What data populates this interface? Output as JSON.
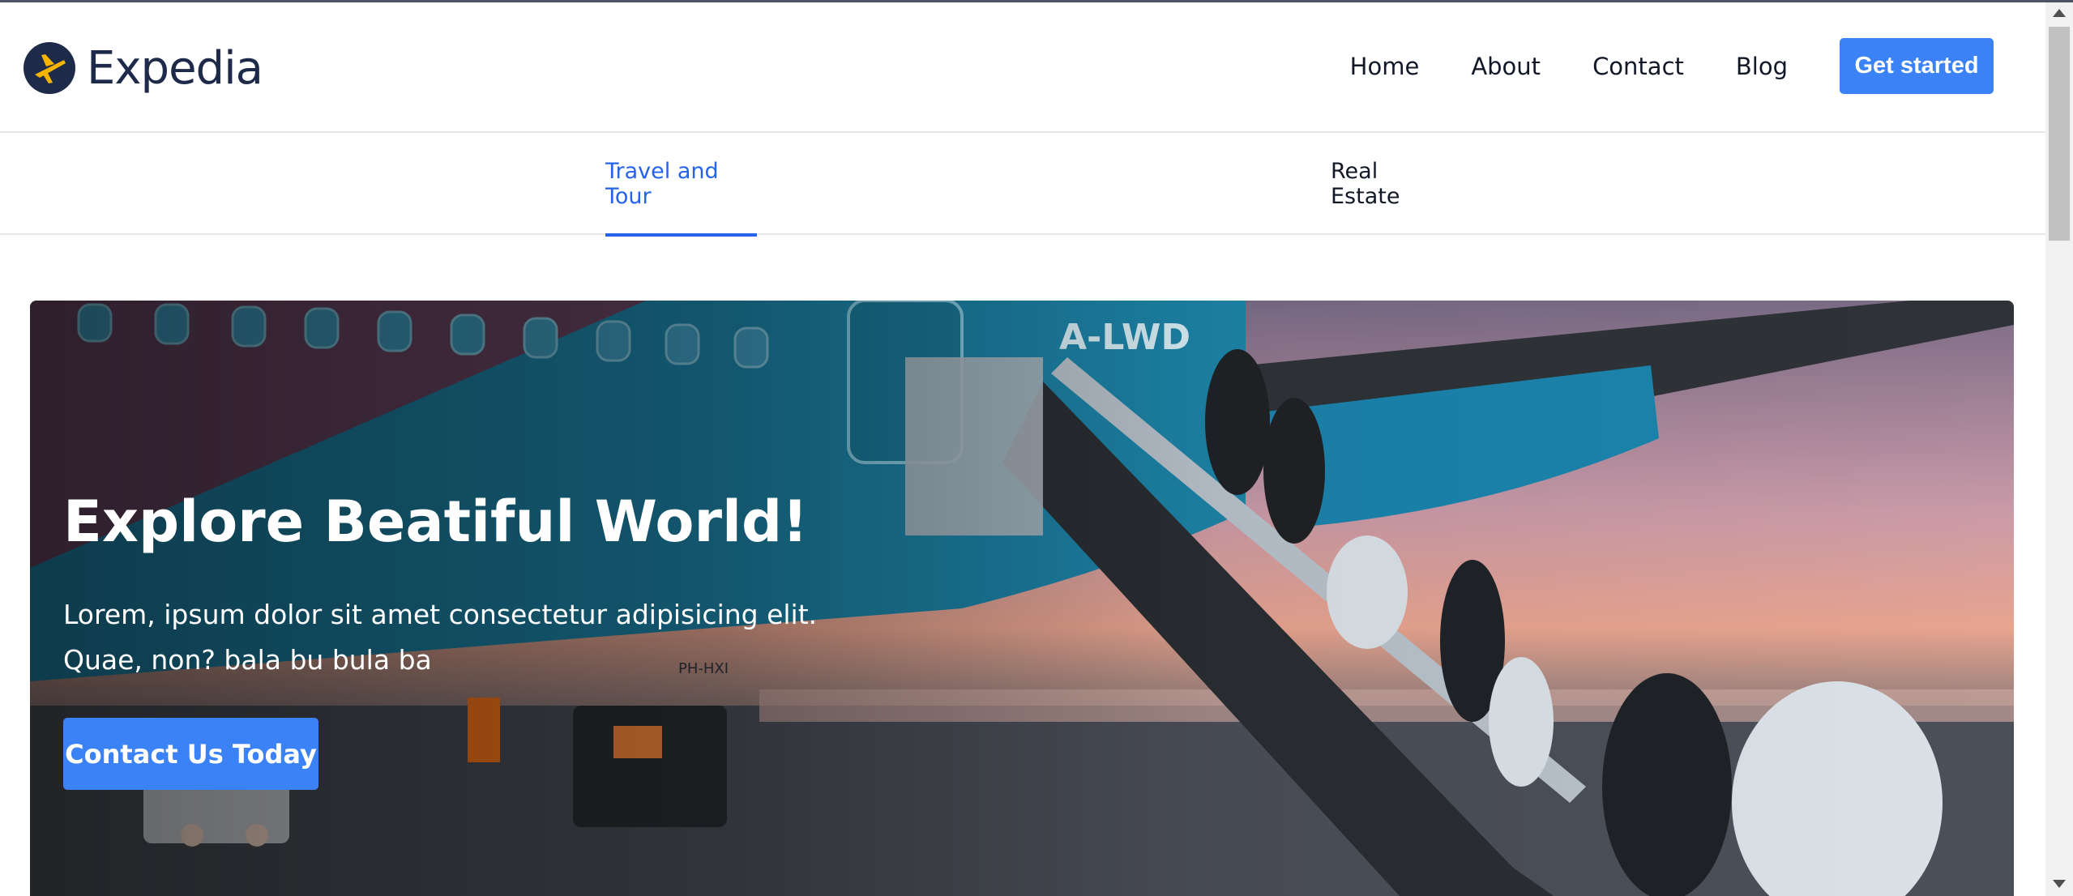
{
  "brand": {
    "name": "Expedia",
    "icon": "airplane-logo-icon"
  },
  "nav": {
    "links": [
      "Home",
      "About",
      "Contact",
      "Blog"
    ],
    "cta_label": "Get started"
  },
  "tabs": [
    {
      "label": "Travel and Tour",
      "active": true
    },
    {
      "label": "Real Estate",
      "active": false
    }
  ],
  "hero": {
    "title": "Explore Beatiful World!",
    "text": "Lorem, ipsum dolor sit amet consectetur adipisicing elit. Quae, non? bala bu bula ba",
    "button_label": "Contact Us Today",
    "image_text": {
      "registration": "A-LWD",
      "side_mark": "PH-HXI"
    }
  },
  "colors": {
    "accent": "#3b82f6",
    "brand_dark": "#1e2a4a",
    "active_tab": "#2563eb"
  }
}
